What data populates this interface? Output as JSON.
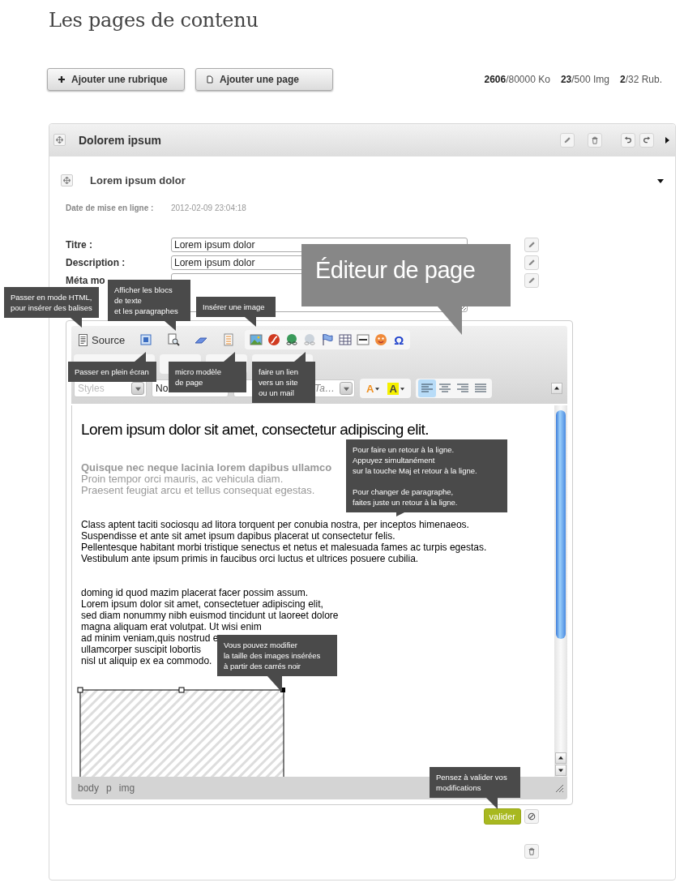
{
  "page_title": "Les pages de contenu",
  "actions": [
    {
      "kind": "add",
      "label": "Ajouter une rubrique"
    },
    {
      "kind": "page",
      "label": "Ajouter une page"
    }
  ],
  "quotas": [
    {
      "used": "2606",
      "limit": "/80000 Ko"
    },
    {
      "used": "23",
      "limit": "/500 Img"
    },
    {
      "used": "2",
      "limit": "/32 Rub."
    }
  ],
  "section": {
    "title": "Dolorem ipsum",
    "expanded": false,
    "page": {
      "title": "Lorem ipsum dolor",
      "expanded": true,
      "date_label": "Date de mise en ligne :",
      "date": "2012-02-09 23:04:18",
      "fields": [
        {
          "kind": "input",
          "label": "Titre :",
          "value": "Lorem ipsum dolor"
        },
        {
          "kind": "input",
          "label": "Description :",
          "value": "Lorem ipsum dolor"
        },
        {
          "kind": "textarea",
          "label": "Méta mo"
        }
      ],
      "editor": {
        "tool_buttons": [
          {
            "kind": "source",
            "label": "Source"
          },
          {
            "kind": "fullscreen"
          },
          {
            "kind": "blocks"
          },
          {
            "kind": "eraser"
          },
          {
            "kind": "template"
          }
        ],
        "insert_group": [
          {
            "kind": "image",
            "disabled": false
          },
          {
            "kind": "flash",
            "disabled": false
          },
          {
            "kind": "link",
            "disabled": false
          },
          {
            "kind": "unlink",
            "disabled": true
          },
          {
            "kind": "anchor",
            "disabled": false
          },
          {
            "kind": "table",
            "disabled": false
          },
          {
            "kind": "rule",
            "disabled": false
          },
          {
            "kind": "smiley",
            "disabled": false
          },
          {
            "kind": "symbol",
            "label": "Ω",
            "disabled": false
          }
        ],
        "combos": [
          {
            "label": "Styles",
            "disabled": true
          },
          {
            "label": "No",
            "disabled": false
          },
          {
            "label": "Ta…",
            "disabled": false
          }
        ],
        "color_buttons": [
          {
            "kind": "text_color",
            "label": "A"
          },
          {
            "kind": "bg_color",
            "label": "A"
          }
        ],
        "align": [
          {
            "kind": "left",
            "selected": true
          },
          {
            "kind": "center",
            "selected": false
          },
          {
            "kind": "right",
            "selected": false
          },
          {
            "kind": "justify",
            "selected": false
          }
        ],
        "content": {
          "heading": "Lorem ipsum dolor sit amet, consectetur adipiscing elit.",
          "subtitle": "Quisque nec neque lacinia lorem dapibus ullamco",
          "grey_lines": [
            "Proin tempor orci mauris, ac vehicula diam.",
            "Praesent feugiat arcu et tellus consequat egestas."
          ],
          "paragraphs": [
            [
              "Class aptent taciti sociosqu ad litora torquent per conubia nostra, per inceptos himenaeos.",
              "Suspendisse et ante sit amet ipsum dapibus placerat ut consectetur felis.",
              "Pellentesque habitant morbi tristique senectus et netus et malesuada fames ac turpis egestas.",
              "Vestibulum ante ipsum primis in faucibus orci luctus et ultrices posuere cubilia."
            ],
            [
              "doming id quod mazim placerat facer possim assum.",
              "Lorem ipsum dolor sit amet, consectetuer adipiscing elit,",
              "sed diam nonummy nibh euismod tincidunt ut laoreet dolore",
              "magna aliquam erat volutpat. Ut wisi enim",
              "ad minim veniam,quis nostrud e",
              "ullamcorper suscipit lobortis",
              "nisl ut aliquip ex ea commodo."
            ]
          ]
        },
        "path": [
          "body",
          "p",
          "img"
        ]
      },
      "submit": "valider"
    }
  },
  "callout": "Éditeur de page",
  "tooltips": [
    "Passer en mode HTML,\npour insérer des balises",
    "Afficher les blocs\nde texte\net les paragraphes",
    "Insérer une image",
    "Passer en plein écran",
    "micro modèle\nde page",
    "faire un lien\nvers un site\nou un mail",
    "Pour faire un retour à la ligne.\nAppuyez simultanément\nsur la touche Maj et retour à la ligne.\n\nPour changer de paragraphe,\nfaites juste un retour à la ligne.",
    "Vous pouvez modifier\nla taille des images insérées\nà partir des carrés noir",
    "Pensez à valider vos\nmodifications"
  ]
}
